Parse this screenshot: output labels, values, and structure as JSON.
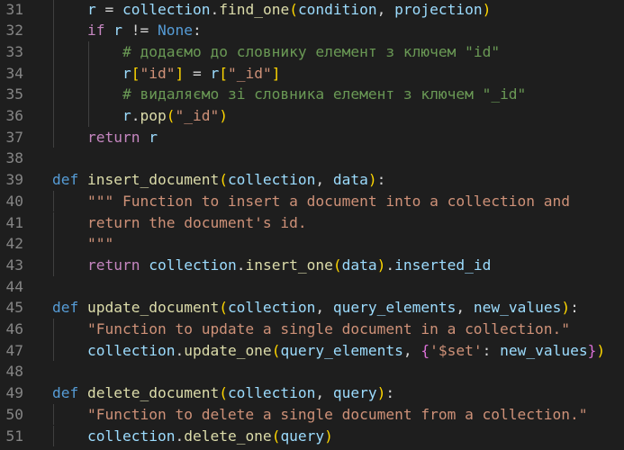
{
  "editor": {
    "theme_background": "#1e1e1e",
    "line_number_color": "#858585",
    "lines": [
      {
        "num": "31",
        "indent": 2,
        "tokens": [
          [
            "var",
            "r"
          ],
          [
            "op",
            " = "
          ],
          [
            "var",
            "collection"
          ],
          [
            "op",
            "."
          ],
          [
            "fn",
            "find_one"
          ],
          [
            "p1",
            "("
          ],
          [
            "var",
            "condition"
          ],
          [
            "op",
            ", "
          ],
          [
            "var",
            "projection"
          ],
          [
            "p1",
            ")"
          ]
        ]
      },
      {
        "num": "32",
        "indent": 2,
        "tokens": [
          [
            "kc",
            "if"
          ],
          [
            "op",
            " "
          ],
          [
            "var",
            "r"
          ],
          [
            "op",
            " != "
          ],
          [
            "cst",
            "None"
          ],
          [
            "op",
            ":"
          ]
        ]
      },
      {
        "num": "33",
        "indent": 3,
        "tokens": [
          [
            "com",
            "# додаємо до словнику елемент з ключем \"id\""
          ]
        ]
      },
      {
        "num": "34",
        "indent": 3,
        "tokens": [
          [
            "var",
            "r"
          ],
          [
            "p1",
            "["
          ],
          [
            "str",
            "\"id\""
          ],
          [
            "p1",
            "]"
          ],
          [
            "op",
            " = "
          ],
          [
            "var",
            "r"
          ],
          [
            "p1",
            "["
          ],
          [
            "str",
            "\"_id\""
          ],
          [
            "p1",
            "]"
          ]
        ]
      },
      {
        "num": "35",
        "indent": 3,
        "tokens": [
          [
            "com",
            "# видаляємо зі словника елемент з ключем \"_id\""
          ]
        ]
      },
      {
        "num": "36",
        "indent": 3,
        "tokens": [
          [
            "var",
            "r"
          ],
          [
            "op",
            "."
          ],
          [
            "fn",
            "pop"
          ],
          [
            "p1",
            "("
          ],
          [
            "str",
            "\"_id\""
          ],
          [
            "p1",
            ")"
          ]
        ]
      },
      {
        "num": "37",
        "indent": 2,
        "tokens": [
          [
            "kc",
            "return"
          ],
          [
            "op",
            " "
          ],
          [
            "var",
            "r"
          ]
        ]
      },
      {
        "num": "38",
        "indent": 0,
        "tokens": []
      },
      {
        "num": "39",
        "indent": 1,
        "tokens": [
          [
            "kw",
            "def"
          ],
          [
            "op",
            " "
          ],
          [
            "fn",
            "insert_document"
          ],
          [
            "p1",
            "("
          ],
          [
            "var",
            "collection"
          ],
          [
            "op",
            ", "
          ],
          [
            "var",
            "data"
          ],
          [
            "p1",
            ")"
          ],
          [
            "op",
            ":"
          ]
        ]
      },
      {
        "num": "40",
        "indent": 2,
        "tokens": [
          [
            "str",
            "\"\"\" Function to insert a document into a collection and"
          ]
        ]
      },
      {
        "num": "41",
        "indent": 2,
        "tokens": [
          [
            "str",
            "return the document's id."
          ]
        ]
      },
      {
        "num": "42",
        "indent": 2,
        "tokens": [
          [
            "str",
            "\"\"\""
          ]
        ]
      },
      {
        "num": "43",
        "indent": 2,
        "tokens": [
          [
            "kc",
            "return"
          ],
          [
            "op",
            " "
          ],
          [
            "var",
            "collection"
          ],
          [
            "op",
            "."
          ],
          [
            "fn",
            "insert_one"
          ],
          [
            "p1",
            "("
          ],
          [
            "var",
            "data"
          ],
          [
            "p1",
            ")"
          ],
          [
            "op",
            "."
          ],
          [
            "var",
            "inserted_id"
          ]
        ]
      },
      {
        "num": "44",
        "indent": 0,
        "tokens": []
      },
      {
        "num": "45",
        "indent": 1,
        "tokens": [
          [
            "kw",
            "def"
          ],
          [
            "op",
            " "
          ],
          [
            "fn",
            "update_document"
          ],
          [
            "p1",
            "("
          ],
          [
            "var",
            "collection"
          ],
          [
            "op",
            ", "
          ],
          [
            "var",
            "query_elements"
          ],
          [
            "op",
            ", "
          ],
          [
            "var",
            "new_values"
          ],
          [
            "p1",
            ")"
          ],
          [
            "op",
            ":"
          ]
        ]
      },
      {
        "num": "46",
        "indent": 2,
        "tokens": [
          [
            "str",
            "\"Function to update a single document in a collection.\""
          ]
        ]
      },
      {
        "num": "47",
        "indent": 2,
        "tokens": [
          [
            "var",
            "collection"
          ],
          [
            "op",
            "."
          ],
          [
            "fn",
            "update_one"
          ],
          [
            "p1",
            "("
          ],
          [
            "var",
            "query_elements"
          ],
          [
            "op",
            ", "
          ],
          [
            "p2",
            "{"
          ],
          [
            "str",
            "'$set'"
          ],
          [
            "op",
            ": "
          ],
          [
            "var",
            "new_values"
          ],
          [
            "p2",
            "}"
          ],
          [
            "p1",
            ")"
          ]
        ]
      },
      {
        "num": "48",
        "indent": 0,
        "tokens": []
      },
      {
        "num": "49",
        "indent": 1,
        "tokens": [
          [
            "kw",
            "def"
          ],
          [
            "op",
            " "
          ],
          [
            "fn",
            "delete_document"
          ],
          [
            "p1",
            "("
          ],
          [
            "var",
            "collection"
          ],
          [
            "op",
            ", "
          ],
          [
            "var",
            "query"
          ],
          [
            "p1",
            ")"
          ],
          [
            "op",
            ":"
          ]
        ]
      },
      {
        "num": "50",
        "indent": 2,
        "tokens": [
          [
            "str",
            "\"Function to delete a single document from a collection.\""
          ]
        ]
      },
      {
        "num": "51",
        "indent": 2,
        "tokens": [
          [
            "var",
            "collection"
          ],
          [
            "op",
            "."
          ],
          [
            "fn",
            "delete_one"
          ],
          [
            "p1",
            "("
          ],
          [
            "var",
            "query"
          ],
          [
            "p1",
            ")"
          ]
        ]
      }
    ]
  }
}
